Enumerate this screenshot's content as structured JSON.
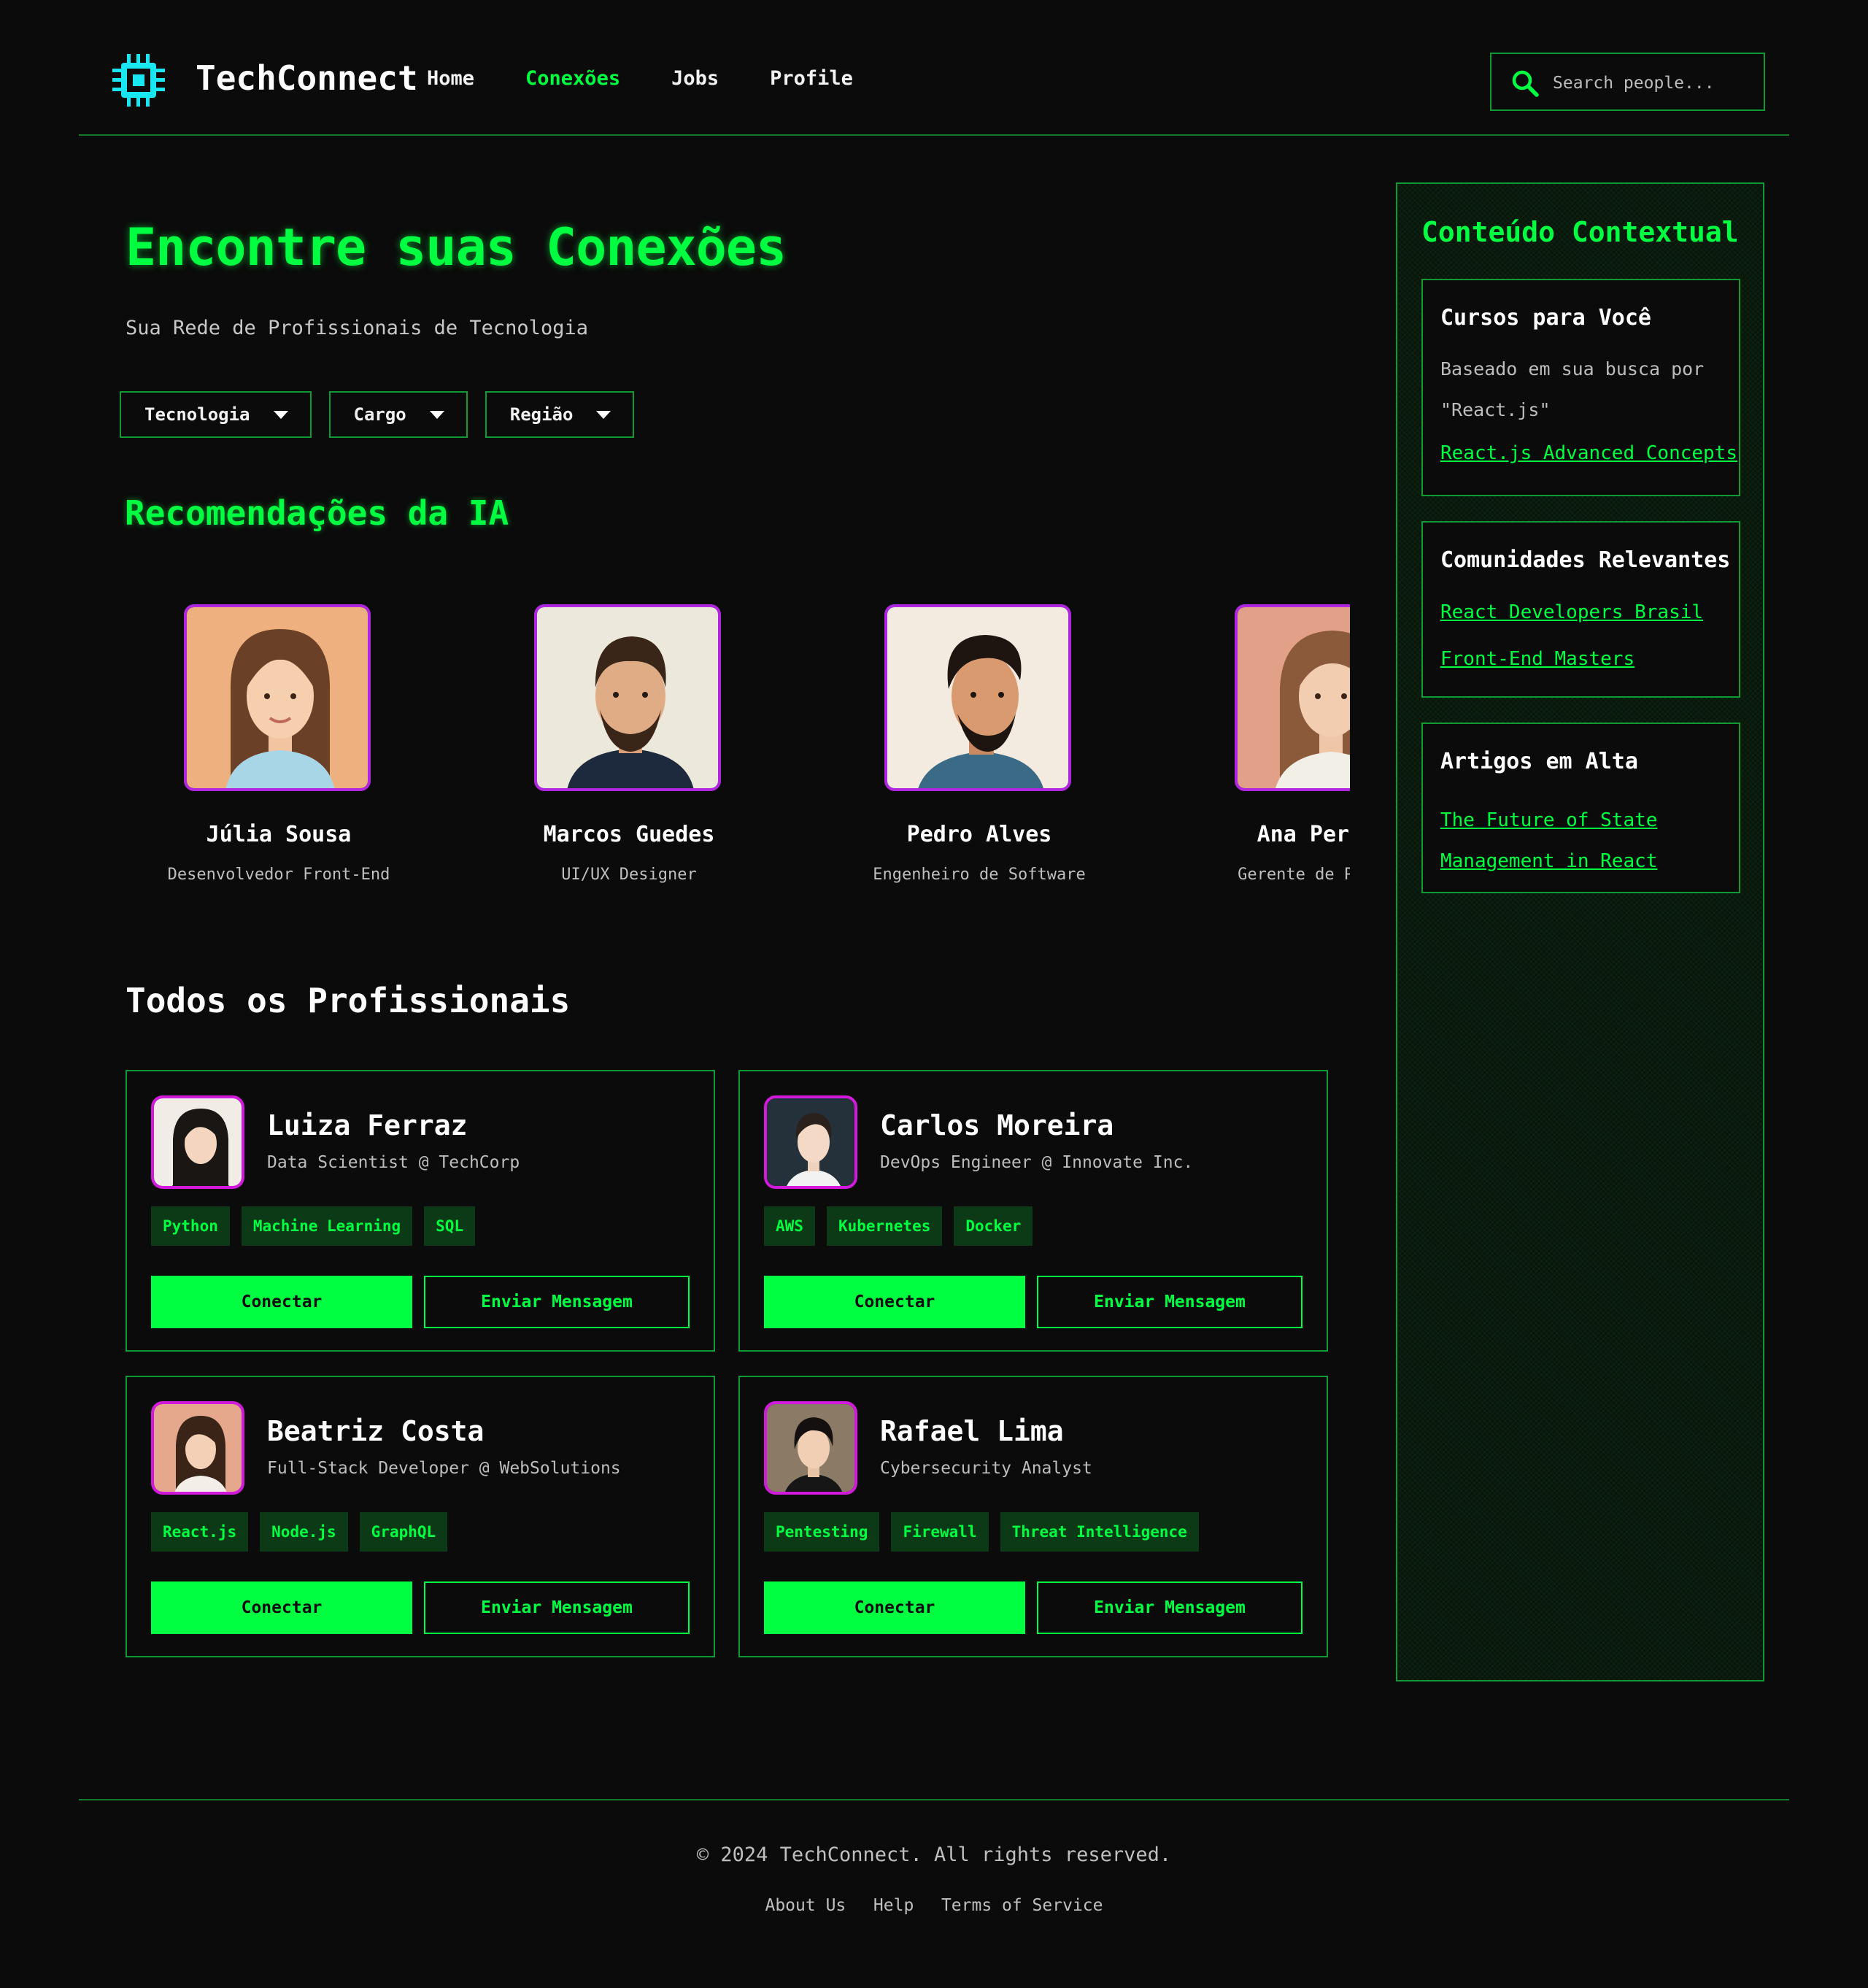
{
  "header": {
    "brand": "TechConnect",
    "nav": [
      "Home",
      "Conexões",
      "Jobs",
      "Profile"
    ],
    "active_nav": "Conexões",
    "search_placeholder": "Search people..."
  },
  "hero": {
    "title": "Encontre suas Conexões",
    "subtitle": "Sua Rede de Profissionais de Tecnologia"
  },
  "filters": [
    "Tecnologia",
    "Cargo",
    "Região"
  ],
  "recommendations": {
    "title": "Recomendações da IA",
    "people": [
      {
        "name": "Júlia Sousa",
        "role": "Desenvolvedor Front-End"
      },
      {
        "name": "Marcos Guedes",
        "role": "UI/UX Designer"
      },
      {
        "name": "Pedro Alves",
        "role": "Engenheiro de Software"
      },
      {
        "name": "Ana Pereira",
        "role": "Gerente de Projetos"
      }
    ]
  },
  "professionals": {
    "title": "Todos os Profissionais",
    "connect_label": "Conectar",
    "message_label": "Enviar Mensagem",
    "items": [
      {
        "name": "Luiza Ferraz",
        "title": "Data Scientist @ TechCorp",
        "tags": [
          "Python",
          "Machine Learning",
          "SQL"
        ]
      },
      {
        "name": "Carlos Moreira",
        "title": "DevOps Engineer @ Innovate Inc.",
        "tags": [
          "AWS",
          "Kubernetes",
          "Docker"
        ]
      },
      {
        "name": "Beatriz Costa",
        "title": "Full-Stack Developer @ WebSolutions",
        "tags": [
          "React.js",
          "Node.js",
          "GraphQL"
        ]
      },
      {
        "name": "Rafael Lima",
        "title": "Cybersecurity Analyst",
        "tags": [
          "Pentesting",
          "Firewall",
          "Threat Intelligence"
        ]
      }
    ]
  },
  "sidebar": {
    "title": "Conteúdo Contextual",
    "courses": {
      "heading": "Cursos para Você",
      "text": "Baseado em sua busca por \"React.js\"",
      "link": "React.js Advanced Concepts"
    },
    "communities": {
      "heading": "Comunidades Relevantes",
      "links": [
        "React Developers Brasil",
        "Front-End Masters"
      ]
    },
    "articles": {
      "heading": "Artigos em Alta",
      "link": "The Future of State Management in React"
    }
  },
  "footer": {
    "copyright": "© 2024 TechConnect. All rights reserved.",
    "links": [
      "About Us",
      "Help",
      "Terms of Service"
    ]
  },
  "colors": {
    "accent": "#00ff41",
    "avatar_border": "#b026e0",
    "background": "#0b0b0b"
  },
  "icons": {
    "logo": "chip-icon",
    "search": "search-icon",
    "filter_caret": "caret-down-icon"
  }
}
